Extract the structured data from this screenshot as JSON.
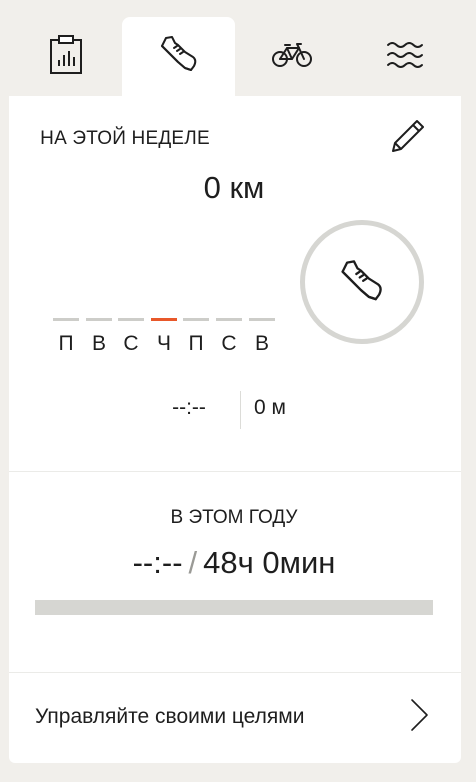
{
  "tabs": [
    {
      "name": "summary",
      "icon": "clipboard-chart-icon",
      "active": false
    },
    {
      "name": "running",
      "icon": "running-shoe-icon",
      "active": true
    },
    {
      "name": "cycling",
      "icon": "bicycle-icon",
      "active": false
    },
    {
      "name": "swimming",
      "icon": "waves-icon",
      "active": false
    }
  ],
  "week": {
    "title": "НА ЭТОЙ НЕДЕЛЕ",
    "distance": "0 км",
    "days": [
      "П",
      "В",
      "С",
      "Ч",
      "П",
      "С",
      "В"
    ],
    "current_day_index": 3,
    "time": "--:--",
    "distance_meters": "0 м"
  },
  "year": {
    "title": "В ЭТОМ ГОДУ",
    "current": "--:--",
    "separator": "/",
    "goal": "48ч 0мин",
    "progress": 0
  },
  "manage": {
    "label": "Управляйте своими целями"
  },
  "colors": {
    "accent": "#e8582a",
    "track": "#d6d6d2",
    "background": "#f1efeb"
  }
}
